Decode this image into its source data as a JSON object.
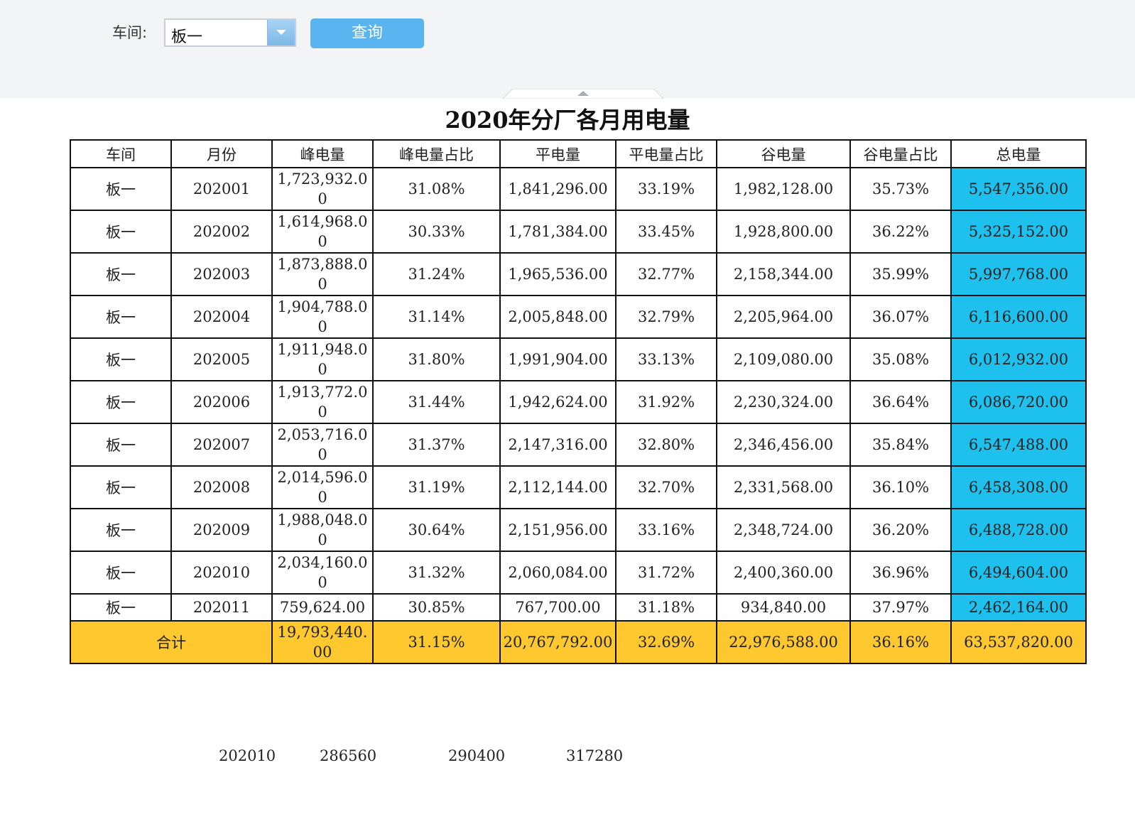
{
  "query": {
    "label": "车间:",
    "workshop_value": "板一",
    "button_label": "查询"
  },
  "report": {
    "title": "2020年分厂各月用电量",
    "headers": [
      "车间",
      "月份",
      "峰电量",
      "峰电量占比",
      "平电量",
      "平电量占比",
      "谷电量",
      "谷电量占比",
      "总电量"
    ],
    "rows": [
      [
        "板一",
        "202001",
        "1,723,932.00",
        "31.08%",
        "1,841,296.00",
        "33.19%",
        "1,982,128.00",
        "35.73%",
        "5,547,356.00"
      ],
      [
        "板一",
        "202002",
        "1,614,968.00",
        "30.33%",
        "1,781,384.00",
        "33.45%",
        "1,928,800.00",
        "36.22%",
        "5,325,152.00"
      ],
      [
        "板一",
        "202003",
        "1,873,888.00",
        "31.24%",
        "1,965,536.00",
        "32.77%",
        "2,158,344.00",
        "35.99%",
        "5,997,768.00"
      ],
      [
        "板一",
        "202004",
        "1,904,788.00",
        "31.14%",
        "2,005,848.00",
        "32.79%",
        "2,205,964.00",
        "36.07%",
        "6,116,600.00"
      ],
      [
        "板一",
        "202005",
        "1,911,948.00",
        "31.80%",
        "1,991,904.00",
        "33.13%",
        "2,109,080.00",
        "35.08%",
        "6,012,932.00"
      ],
      [
        "板一",
        "202006",
        "1,913,772.00",
        "31.44%",
        "1,942,624.00",
        "31.92%",
        "2,230,324.00",
        "36.64%",
        "6,086,720.00"
      ],
      [
        "板一",
        "202007",
        "2,053,716.00",
        "31.37%",
        "2,147,316.00",
        "32.80%",
        "2,346,456.00",
        "35.84%",
        "6,547,488.00"
      ],
      [
        "板一",
        "202008",
        "2,014,596.00",
        "31.19%",
        "2,112,144.00",
        "32.70%",
        "2,331,568.00",
        "36.10%",
        "6,458,308.00"
      ],
      [
        "板一",
        "202009",
        "1,988,048.00",
        "30.64%",
        "2,151,956.00",
        "33.16%",
        "2,348,724.00",
        "36.20%",
        "6,488,728.00"
      ],
      [
        "板一",
        "202010",
        "2,034,160.00",
        "31.32%",
        "2,060,084.00",
        "31.72%",
        "2,400,360.00",
        "36.96%",
        "6,494,604.00"
      ],
      [
        "板一",
        "202011",
        "759,624.00",
        "30.85%",
        "767,700.00",
        "31.18%",
        "934,840.00",
        "37.97%",
        "2,462,164.00"
      ]
    ],
    "total": {
      "label": "合计",
      "values": [
        "19,793,440.00",
        "31.15%",
        "20,767,792.00",
        "32.69%",
        "22,976,588.00",
        "36.16%",
        "63,537,820.00"
      ]
    }
  },
  "footer_values": [
    "202010",
    "286560",
    "290400",
    "317280"
  ],
  "colors": {
    "total_column": "#1ec0ee",
    "total_row": "#ffc82e",
    "query_button": "#5ab4f0"
  }
}
